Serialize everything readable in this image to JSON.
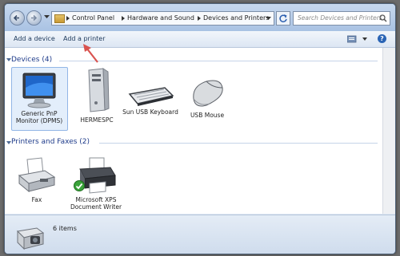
{
  "address": {
    "crumbs": [
      "Control Panel",
      "Hardware and Sound",
      "Devices and Printers"
    ]
  },
  "search": {
    "placeholder": "Search Devices and Printers"
  },
  "toolbar": {
    "add_device": "Add a device",
    "add_printer": "Add a printer",
    "help": "?"
  },
  "groups": {
    "devices": {
      "title": "Devices (4)",
      "items": [
        {
          "label": "Generic PnP Monitor (DPMS)",
          "icon": "monitor-icon"
        },
        {
          "label": "HERMESPC",
          "icon": "computer-tower-icon"
        },
        {
          "label": "Sun USB Keyboard",
          "icon": "keyboard-icon"
        },
        {
          "label": "USB Mouse",
          "icon": "mouse-icon"
        }
      ]
    },
    "printers": {
      "title": "Printers and Faxes (2)",
      "items": [
        {
          "label": "Fax",
          "icon": "fax-icon"
        },
        {
          "label": "Microsoft XPS Document Writer",
          "icon": "printer-icon"
        }
      ]
    }
  },
  "status": {
    "count": "6 items",
    "icon": "camera-printer-icon"
  },
  "colors": {
    "accent": "#1e3b8a",
    "annotation_arrow": "#d9534f"
  }
}
